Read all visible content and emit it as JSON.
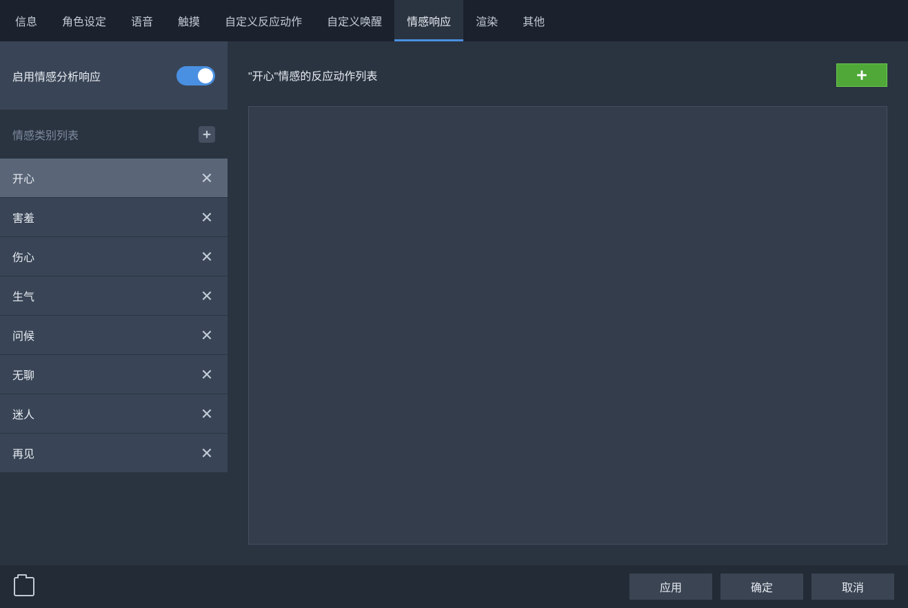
{
  "tabs": [
    {
      "label": "信息"
    },
    {
      "label": "角色设定"
    },
    {
      "label": "语音"
    },
    {
      "label": "触摸"
    },
    {
      "label": "自定义反应动作"
    },
    {
      "label": "自定义唤醒"
    },
    {
      "label": "情感响应",
      "active": true
    },
    {
      "label": "渲染"
    },
    {
      "label": "其他"
    }
  ],
  "sidebar": {
    "enable_label": "启用情感分析响应",
    "enable_on": true,
    "category_header": "情感类别列表",
    "categories": [
      {
        "label": "开心",
        "selected": true
      },
      {
        "label": "害羞"
      },
      {
        "label": "伤心"
      },
      {
        "label": "生气"
      },
      {
        "label": "问候"
      },
      {
        "label": "无聊"
      },
      {
        "label": "迷人"
      },
      {
        "label": "再见"
      }
    ]
  },
  "main": {
    "title": "\"开心\"情感的反应动作列表"
  },
  "footer": {
    "apply": "应用",
    "ok": "确定",
    "cancel": "取消"
  }
}
